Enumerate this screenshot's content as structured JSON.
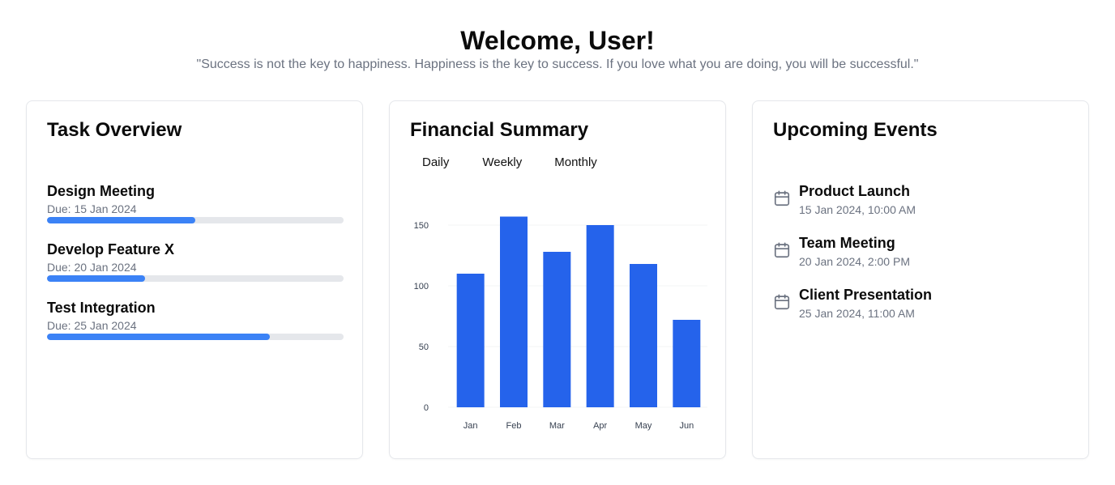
{
  "header": {
    "title": "Welcome, User!",
    "quote": "\"Success is not the key to happiness. Happiness is the key to success. If you love what you are doing, you will be successful.\""
  },
  "tasks": {
    "title": "Task Overview",
    "items": [
      {
        "name": "Design Meeting",
        "due": "Due: 15 Jan 2024",
        "progress": 0.5
      },
      {
        "name": "Develop Feature X",
        "due": "Due: 20 Jan 2024",
        "progress": 0.33
      },
      {
        "name": "Test Integration",
        "due": "Due: 25 Jan 2024",
        "progress": 0.75
      }
    ]
  },
  "finance": {
    "title": "Financial Summary",
    "tabs": [
      "Daily",
      "Weekly",
      "Monthly"
    ]
  },
  "chart_data": {
    "type": "bar",
    "categories": [
      "Jan",
      "Feb",
      "Mar",
      "Apr",
      "May",
      "Jun"
    ],
    "values": [
      110,
      157,
      128,
      150,
      118,
      72
    ],
    "yticks": [
      0,
      50,
      100,
      150
    ],
    "ylim": [
      0,
      175
    ],
    "grid": true,
    "color": "#2563eb"
  },
  "events": {
    "title": "Upcoming Events",
    "icon": "calendar-icon",
    "items": [
      {
        "name": "Product Launch",
        "time": "15 Jan 2024, 10:00 AM"
      },
      {
        "name": "Team Meeting",
        "time": "20 Jan 2024, 2:00 PM"
      },
      {
        "name": "Client Presentation",
        "time": "25 Jan 2024, 11:00 AM"
      }
    ]
  },
  "colors": {
    "accent": "#3b82f6",
    "chart_bar": "#2563eb",
    "muted_text": "#6b7280",
    "track": "#e5e7eb"
  }
}
